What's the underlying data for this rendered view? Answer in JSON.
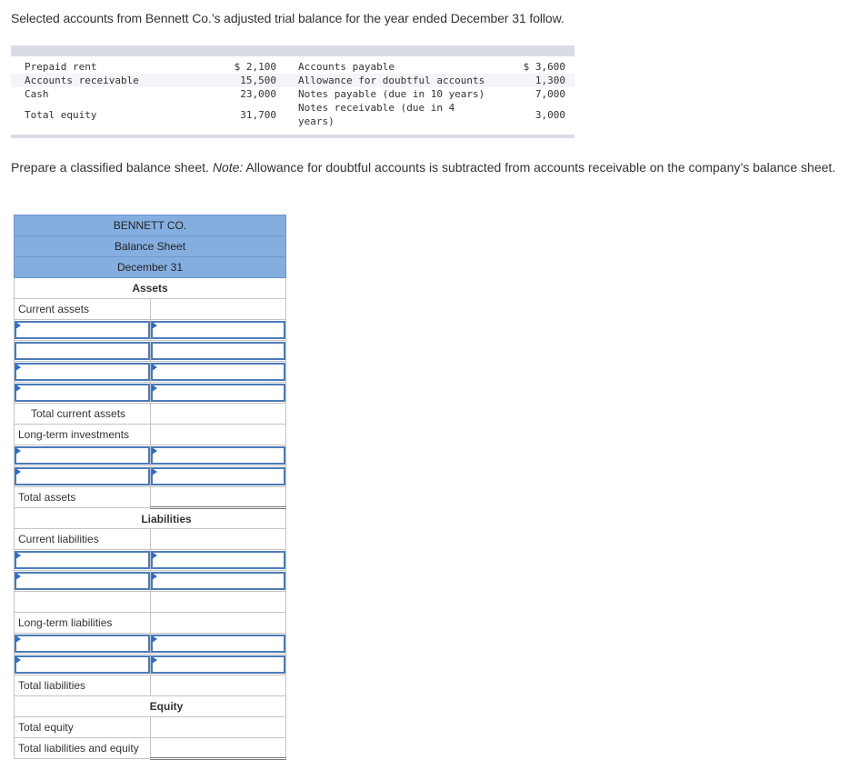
{
  "intro": "Selected accounts from Bennett Co.’s adjusted trial balance for the year ended December 31 follow.",
  "trial_balance": {
    "col1": [
      "Prepaid rent",
      "Accounts receivable",
      "Cash",
      "Total equity"
    ],
    "col2": [
      "$ 2,100",
      "15,500",
      "23,000",
      "31,700"
    ],
    "col3": [
      "Accounts payable",
      "Allowance for doubtful accounts",
      "Notes payable (due in 10 years)",
      "Notes receivable (due in 4",
      "years)"
    ],
    "col4": [
      "$ 3,600",
      "1,300",
      "7,000",
      "3,000"
    ]
  },
  "instructions": {
    "main": "Prepare a classified balance sheet. ",
    "note_label": "Note:",
    "note_text": " Allowance for doubtful accounts is subtracted from accounts receivable on the company’s balance sheet."
  },
  "balance_sheet": {
    "company": "BENNETT CO.",
    "title": "Balance Sheet",
    "date": "December 31",
    "assets_heading": "Assets",
    "current_assets": "Current assets",
    "total_current_assets": "Total current assets",
    "long_term_investments": "Long-term investments",
    "total_assets": "Total assets",
    "liabilities_heading": "Liabilities",
    "current_liabilities": "Current liabilities",
    "long_term_liabilities": "Long-term liabilities",
    "total_liabilities": "Total liabilities",
    "equity_heading": "Equity",
    "total_equity": "Total equity",
    "total_liabilities_and_equity": "Total liabilities and equity"
  }
}
